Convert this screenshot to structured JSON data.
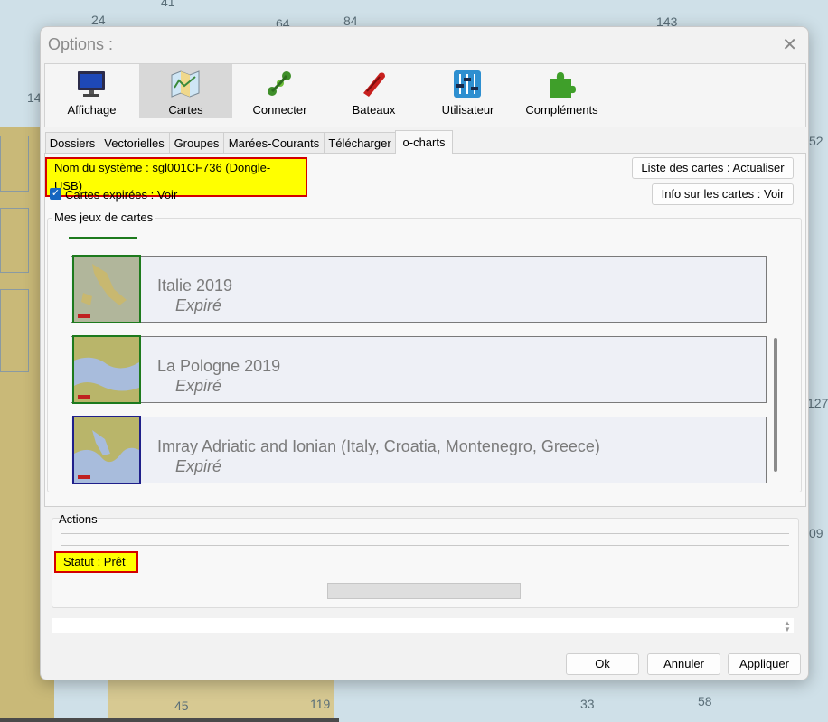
{
  "background": {
    "depth_labels": [
      "24",
      "41",
      "64",
      "84",
      "143",
      "14",
      "52",
      "127",
      "09",
      "45",
      "119",
      "33",
      "58"
    ]
  },
  "dialog": {
    "title": "Options :",
    "close_glyph": "✕",
    "toolbar": [
      {
        "label": "Affichage",
        "icon": "monitor-icon"
      },
      {
        "label": "Cartes",
        "icon": "map-icon"
      },
      {
        "label": "Connecter",
        "icon": "connect-icon"
      },
      {
        "label": "Bateaux",
        "icon": "boat-icon"
      },
      {
        "label": "Utilisateur",
        "icon": "sliders-icon"
      },
      {
        "label": "Compléments",
        "icon": "puzzle-icon"
      }
    ],
    "tabs": [
      "Dossiers",
      "Vectorielles",
      "Groupes",
      "Marées-Courants",
      "Télécharger",
      "o-charts"
    ],
    "system_name": "Nom du système : sgl001CF736 (Dongle-USB)",
    "btn_refresh": "Liste des cartes : Actualiser",
    "btn_info": "Info sur les cartes : Voir",
    "expired_checkbox": "Cartes expirées : Voir",
    "chartsets_label": "Mes jeux de cartes",
    "chartsets": [
      {
        "name": "Italie 2019",
        "status": "Expiré"
      },
      {
        "name": "La Pologne 2019",
        "status": "Expiré"
      },
      {
        "name": "Imray Adriatic and Ionian (Italy, Croatia, Montenegro, Greece)",
        "status": "Expiré"
      }
    ],
    "actions_label": "Actions",
    "status": "Statut : Prêt",
    "buttons": {
      "ok": "Ok",
      "cancel": "Annuler",
      "apply": "Appliquer"
    }
  },
  "colors": {
    "highlight": "#ffff00",
    "highlight_border": "#d40000",
    "checkbox": "#1565c0"
  }
}
